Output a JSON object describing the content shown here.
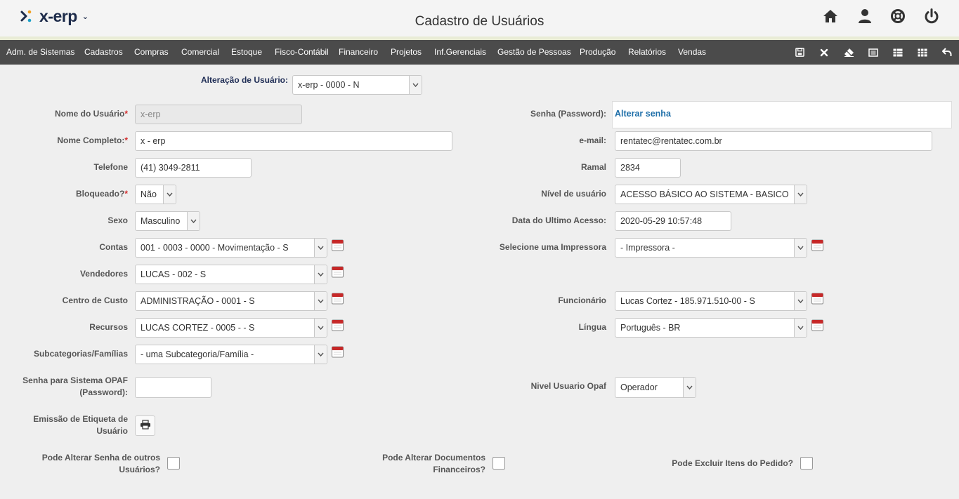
{
  "header": {
    "logo_text": "x-erp",
    "title": "Cadastro de Usuários",
    "icons": [
      "home-icon",
      "user-icon",
      "lifebuoy-icon",
      "power-icon"
    ]
  },
  "menu": {
    "items": [
      "Adm. de Sistemas",
      "Cadastros",
      "Compras",
      "Comercial",
      "Estoque",
      "Fisco-Contábil",
      "Financeiro",
      "Projetos",
      "Inf.Gerenciais",
      "Gestão de Pessoas",
      "Produção",
      "Relatórios",
      "Vendas"
    ],
    "toolbar_icons": [
      "save-icon",
      "close-icon",
      "eraser-icon",
      "list-icon",
      "grid-icon",
      "grid-alt-icon",
      "undo-icon"
    ]
  },
  "form": {
    "alteracao": {
      "label": "Alteração de Usuário:",
      "value": "x-erp - 0000 - N"
    },
    "nome_usuario": {
      "label": "Nome do Usuário",
      "value": "x-erp"
    },
    "senha": {
      "label": "Senha (Password):",
      "link": "Alterar senha"
    },
    "nome_completo": {
      "label": "Nome Completo:",
      "value": "x - erp"
    },
    "email": {
      "label": "e-mail:",
      "value": "rentatec@rentatec.com.br"
    },
    "telefone": {
      "label": "Telefone",
      "value": "(41) 3049-2811"
    },
    "ramal": {
      "label": "Ramal",
      "value": "2834"
    },
    "bloqueado": {
      "label": "Bloqueado?",
      "value": "Não"
    },
    "nivel_usuario": {
      "label": "Nível de usuário",
      "value": "ACESSO BÁSICO AO SISTEMA - BASICO"
    },
    "sexo": {
      "label": "Sexo",
      "value": "Masculino"
    },
    "ultimo_acesso": {
      "label": "Data do Ultimo Acesso:",
      "value": "2020-05-29 10:57:48"
    },
    "contas": {
      "label": "Contas",
      "value": "001 - 0003 - 0000 - Movimentação - S"
    },
    "impressora": {
      "label": "Selecione uma Impressora",
      "value": "- Impressora -"
    },
    "vendedores": {
      "label": "Vendedores",
      "value": "LUCAS - 002 - S"
    },
    "centro_custo": {
      "label": "Centro de Custo",
      "value": "ADMINISTRAÇÃO - 0001 - S"
    },
    "funcionario": {
      "label": "Funcionário",
      "value": "Lucas Cortez - 185.971.510-00 - S"
    },
    "recursos": {
      "label": "Recursos",
      "value": "LUCAS CORTEZ - 0005 - - S"
    },
    "lingua": {
      "label": "Língua",
      "value": "Português - BR"
    },
    "subcategorias": {
      "label": "Subcategorias/Famílias",
      "value": "- uma Subcategoria/Família -"
    },
    "senha_opaf": {
      "label_1": "Senha para Sistema OPAF",
      "label_2": "(Password):",
      "value": ""
    },
    "nivel_opaf": {
      "label": "Nivel Usuario Opaf",
      "value": "Operador"
    },
    "etiqueta": {
      "label_1": "Emissão de Etiqueta de",
      "label_2": "Usuário"
    },
    "pode_alterar_senha": {
      "label_1": "Pode Alterar Senha de outros",
      "label_2": "Usuários?",
      "checked": false
    },
    "pode_alterar_docs": {
      "label_1": "Pode Alterar Documentos",
      "label_2": "Financeiros?",
      "checked": false
    },
    "pode_excluir": {
      "label": "Pode Excluir Itens do Pedido?",
      "checked": false
    },
    "required_mark": "*"
  },
  "colors": {
    "menubar_bg": "#4b4b4b",
    "link": "#1f6fa9",
    "required": "#d32f2f",
    "calendar_red": "#c62828"
  }
}
